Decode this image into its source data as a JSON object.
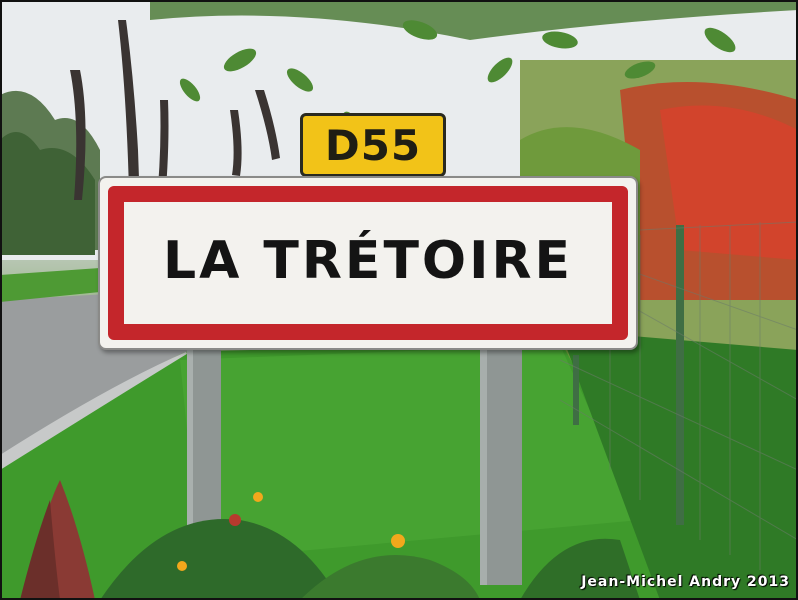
{
  "photo": {
    "sign": {
      "name": "LA TRÉTOIRE",
      "border_color": "#c4262b",
      "background_color": "#f3f2ee",
      "text_color": "#141414"
    },
    "road_plate": {
      "label": "D55",
      "background_color": "#f2c318"
    },
    "credit": "Jean-Michel  Andry 2013"
  }
}
